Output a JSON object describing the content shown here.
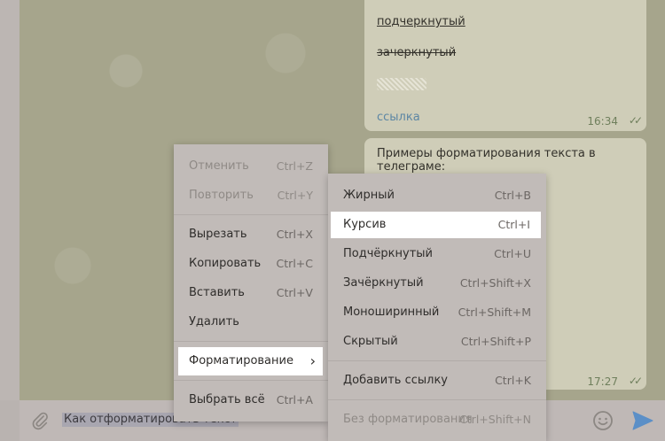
{
  "chat": {
    "bubble_top": {
      "underlined": "подчеркнутый",
      "strikethrough": "зачеркнутый",
      "link": "ссылка",
      "time": "16:34",
      "checks": "✓✓"
    },
    "bubble_bottom": {
      "text": "Примеры форматирования текста в телеграме:",
      "time": "17:27",
      "checks": "✓✓"
    }
  },
  "input": {
    "value": "Как отформатировать текст"
  },
  "context_menu": {
    "items": [
      {
        "label": "Отменить",
        "shortcut": "Ctrl+Z"
      },
      {
        "label": "Повторить",
        "shortcut": "Ctrl+Y"
      },
      {
        "label": "Вырезать",
        "shortcut": "Ctrl+X"
      },
      {
        "label": "Копировать",
        "shortcut": "Ctrl+C"
      },
      {
        "label": "Вставить",
        "shortcut": "Ctrl+V"
      },
      {
        "label": "Удалить",
        "shortcut": ""
      },
      {
        "label": "Форматирование",
        "shortcut": "›"
      },
      {
        "label": "Выбрать всё",
        "shortcut": "Ctrl+A"
      }
    ]
  },
  "format_menu": {
    "items": [
      {
        "label": "Жирный",
        "shortcut": "Ctrl+B"
      },
      {
        "label": "Курсив",
        "shortcut": "Ctrl+I"
      },
      {
        "label": "Подчёркнутый",
        "shortcut": "Ctrl+U"
      },
      {
        "label": "Зачёркнутый",
        "shortcut": "Ctrl+Shift+X"
      },
      {
        "label": "Моноширинный",
        "shortcut": "Ctrl+Shift+M"
      },
      {
        "label": "Скрытый",
        "shortcut": "Ctrl+Shift+P"
      },
      {
        "label": "Добавить ссылку",
        "shortcut": "Ctrl+K"
      },
      {
        "label": "Без форматирования",
        "shortcut": "Ctrl+Shift+N"
      }
    ]
  },
  "colors": {
    "highlight": "#ffffff",
    "send_icon": "#5b8fc7"
  }
}
